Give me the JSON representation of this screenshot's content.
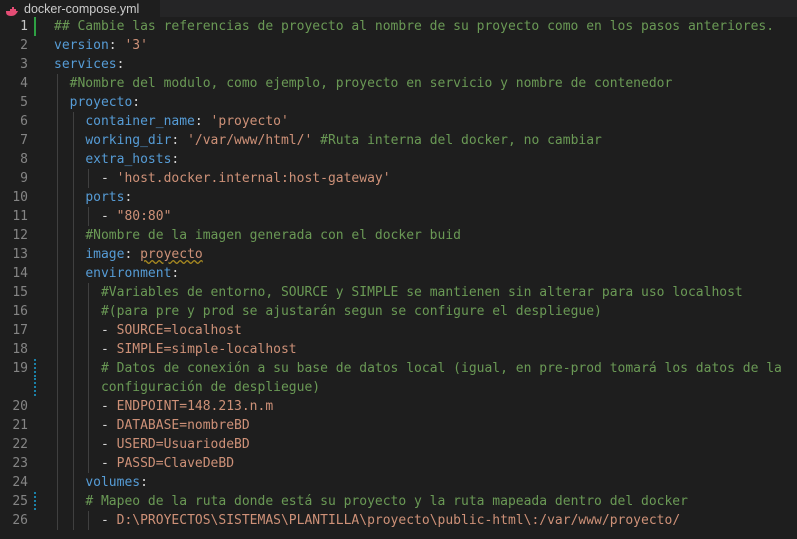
{
  "tab": {
    "title": "docker-compose.yml",
    "icon": "docker-whale-icon"
  },
  "colors": {
    "comment": "#6a9955",
    "key": "#569cd6",
    "string": "#ce9178",
    "punct": "#d4d4d4",
    "line_number": "#858585",
    "background": "#1e1e1e"
  },
  "editor": {
    "lines": [
      {
        "n": "1",
        "tokens": [
          [
            "c",
            "## Cambie las referencias de proyecto al nombre de su proyecto como en los pasos anteriores."
          ]
        ]
      },
      {
        "n": "2",
        "tokens": [
          [
            "k",
            "version"
          ],
          [
            "p",
            ": "
          ],
          [
            "s",
            "'3'"
          ]
        ]
      },
      {
        "n": "3",
        "tokens": [
          [
            "k",
            "services"
          ],
          [
            "p",
            ":"
          ]
        ]
      },
      {
        "n": "4",
        "tokens": [
          [
            "p",
            "  "
          ],
          [
            "c",
            "#Nombre del modulo, como ejemplo, proyecto en servicio y nombre de contenedor"
          ]
        ]
      },
      {
        "n": "5",
        "tokens": [
          [
            "p",
            "  "
          ],
          [
            "k",
            "proyecto"
          ],
          [
            "p",
            ":"
          ]
        ]
      },
      {
        "n": "6",
        "tokens": [
          [
            "p",
            "    "
          ],
          [
            "k",
            "container_name"
          ],
          [
            "p",
            ": "
          ],
          [
            "s",
            "'proyecto'"
          ]
        ]
      },
      {
        "n": "7",
        "tokens": [
          [
            "p",
            "    "
          ],
          [
            "k",
            "working_dir"
          ],
          [
            "p",
            ": "
          ],
          [
            "s",
            "'/var/www/html/'"
          ],
          [
            "p",
            " "
          ],
          [
            "c",
            "#Ruta interna del docker, no cambiar"
          ]
        ]
      },
      {
        "n": "8",
        "tokens": [
          [
            "p",
            "    "
          ],
          [
            "k",
            "extra_hosts"
          ],
          [
            "p",
            ":"
          ]
        ]
      },
      {
        "n": "9",
        "tokens": [
          [
            "p",
            "      - "
          ],
          [
            "s",
            "'host.docker.internal:host-gateway'"
          ]
        ]
      },
      {
        "n": "10",
        "tokens": [
          [
            "p",
            "    "
          ],
          [
            "k",
            "ports"
          ],
          [
            "p",
            ":"
          ]
        ]
      },
      {
        "n": "11",
        "tokens": [
          [
            "p",
            "      - "
          ],
          [
            "s",
            "\"80:80\""
          ]
        ]
      },
      {
        "n": "12",
        "tokens": [
          [
            "p",
            "    "
          ],
          [
            "c",
            "#Nombre de la imagen generada con el docker buid"
          ]
        ]
      },
      {
        "n": "13",
        "tokens": [
          [
            "p",
            "    "
          ],
          [
            "k",
            "image"
          ],
          [
            "p",
            ": "
          ],
          [
            "h",
            "proyecto"
          ]
        ]
      },
      {
        "n": "14",
        "tokens": [
          [
            "p",
            "    "
          ],
          [
            "k",
            "environment"
          ],
          [
            "p",
            ":"
          ]
        ]
      },
      {
        "n": "15",
        "tokens": [
          [
            "p",
            "      "
          ],
          [
            "c",
            "#Variables de entorno, SOURCE y SIMPLE se mantienen sin alterar para uso localhost"
          ]
        ]
      },
      {
        "n": "16",
        "tokens": [
          [
            "p",
            "      "
          ],
          [
            "c",
            "#(para pre y prod se ajustarán segun se configure el despliegue)"
          ]
        ]
      },
      {
        "n": "17",
        "tokens": [
          [
            "p",
            "      - "
          ],
          [
            "s",
            "SOURCE=localhost"
          ]
        ]
      },
      {
        "n": "18",
        "tokens": [
          [
            "p",
            "      - "
          ],
          [
            "s",
            "SIMPLE=simple-localhost"
          ]
        ]
      },
      {
        "n": "19",
        "tokens": [
          [
            "p",
            "      "
          ],
          [
            "c",
            "# Datos de conexión a su base de datos local (igual, en pre-prod tomará los datos de la"
          ]
        ]
      },
      {
        "n": "",
        "tokens": [
          [
            "p",
            "      "
          ],
          [
            "c",
            "configuración de despliegue)"
          ]
        ]
      },
      {
        "n": "20",
        "tokens": [
          [
            "p",
            "      - "
          ],
          [
            "s",
            "ENDPOINT=148.213.n.m"
          ]
        ]
      },
      {
        "n": "21",
        "tokens": [
          [
            "p",
            "      - "
          ],
          [
            "s",
            "DATABASE=nombreBD"
          ]
        ]
      },
      {
        "n": "22",
        "tokens": [
          [
            "p",
            "      - "
          ],
          [
            "s",
            "USERD=UsuariodeBD"
          ]
        ]
      },
      {
        "n": "23",
        "tokens": [
          [
            "p",
            "      - "
          ],
          [
            "s",
            "PASSD=ClaveDeBD"
          ]
        ]
      },
      {
        "n": "24",
        "tokens": [
          [
            "p",
            "    "
          ],
          [
            "k",
            "volumes"
          ],
          [
            "p",
            ":"
          ]
        ]
      },
      {
        "n": "25",
        "tokens": [
          [
            "p",
            "    "
          ],
          [
            "c",
            "# Mapeo de la ruta donde está su proyecto y la ruta mapeada dentro del docker"
          ]
        ]
      },
      {
        "n": "26",
        "tokens": [
          [
            "p",
            "      - "
          ],
          [
            "s",
            "D:\\PROYECTOS\\SISTEMAS\\PLANTILLA\\proyecto\\public-html\\:/var/www/proyecto/"
          ]
        ]
      }
    ]
  }
}
